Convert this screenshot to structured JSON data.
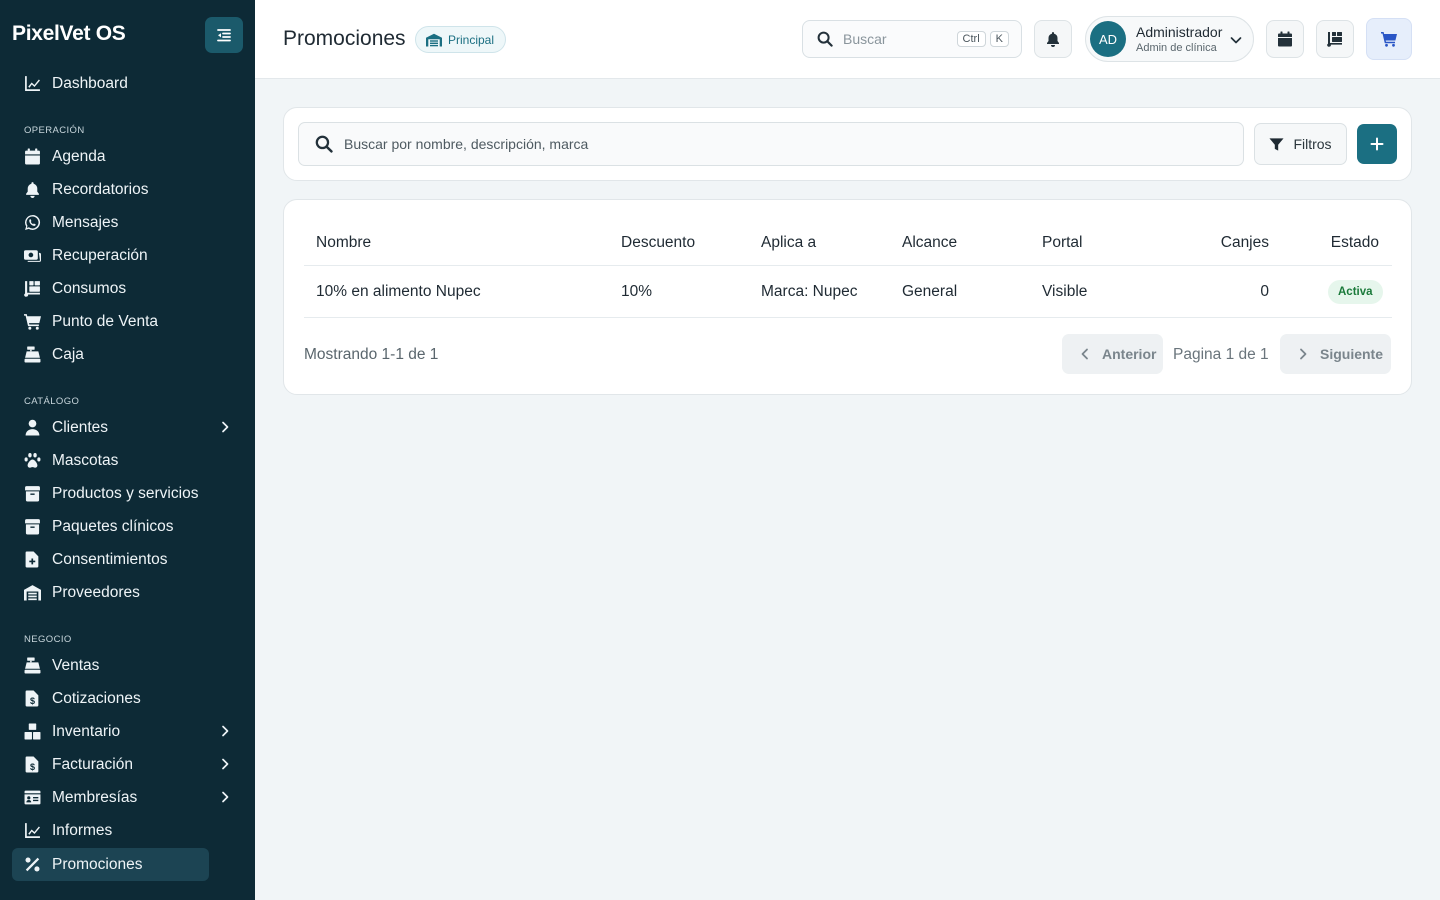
{
  "sidebar": {
    "brand": "PixelVet OS",
    "top_items": [
      {
        "label": "Dashboard",
        "icon": "chart-line-icon"
      }
    ],
    "sections": [
      {
        "label": "OPERACIÓN",
        "items": [
          {
            "label": "Agenda",
            "icon": "calendar-icon"
          },
          {
            "label": "Recordatorios",
            "icon": "bell-icon"
          },
          {
            "label": "Mensajes",
            "icon": "whatsapp-icon"
          },
          {
            "label": "Recuperación",
            "icon": "money-icon"
          },
          {
            "label": "Consumos",
            "icon": "dolly-icon"
          },
          {
            "label": "Punto de Venta",
            "icon": "cart-icon"
          },
          {
            "label": "Caja",
            "icon": "cash-register-icon"
          }
        ]
      },
      {
        "label": "CATÁLOGO",
        "items": [
          {
            "label": "Clientes",
            "icon": "user-icon",
            "expandable": true
          },
          {
            "label": "Mascotas",
            "icon": "paw-icon"
          },
          {
            "label": "Productos y servicios",
            "icon": "box-icon"
          },
          {
            "label": "Paquetes clínicos",
            "icon": "box-icon"
          },
          {
            "label": "Consentimientos",
            "icon": "file-medical-icon"
          },
          {
            "label": "Proveedores",
            "icon": "warehouse-icon"
          }
        ]
      },
      {
        "label": "NEGOCIO",
        "items": [
          {
            "label": "Ventas",
            "icon": "cash-register-icon"
          },
          {
            "label": "Cotizaciones",
            "icon": "file-invoice-dollar-icon"
          },
          {
            "label": "Inventario",
            "icon": "boxes-icon",
            "expandable": true
          },
          {
            "label": "Facturación",
            "icon": "file-invoice-dollar-icon",
            "expandable": true
          },
          {
            "label": "Membresías",
            "icon": "id-card-icon",
            "expandable": true
          },
          {
            "label": "Informes",
            "icon": "chart-line-icon"
          },
          {
            "label": "Promociones",
            "icon": "percent-icon",
            "active": true
          }
        ]
      }
    ]
  },
  "header": {
    "title": "Promociones",
    "branch": "Principal",
    "search_placeholder": "Buscar",
    "shortcut_keys": [
      "Ctrl",
      "K"
    ],
    "user": {
      "initials": "AD",
      "name": "Administrador",
      "role": "Admin de clínica"
    }
  },
  "toolbar": {
    "search_placeholder": "Buscar por nombre, descripción, marca",
    "filters_label": "Filtros"
  },
  "table": {
    "columns": [
      "Nombre",
      "Descuento",
      "Aplica a",
      "Alcance",
      "Portal",
      "Canjes",
      "Estado"
    ],
    "rows": [
      {
        "nombre": "10% en alimento Nupec",
        "descuento": "10%",
        "aplica_a": "Marca: Nupec",
        "alcance": "General",
        "portal": "Visible",
        "canjes": "0",
        "estado": "Activa"
      }
    ]
  },
  "pagination": {
    "showing": "Mostrando 1-1 de 1",
    "prev_label": "Anterior",
    "page_text": "Pagina 1 de 1",
    "next_label": "Siguiente"
  },
  "colors": {
    "sidebar_bg": "#0d2a36",
    "accent": "#1b6f82",
    "active_badge": "#1a7a3a"
  }
}
